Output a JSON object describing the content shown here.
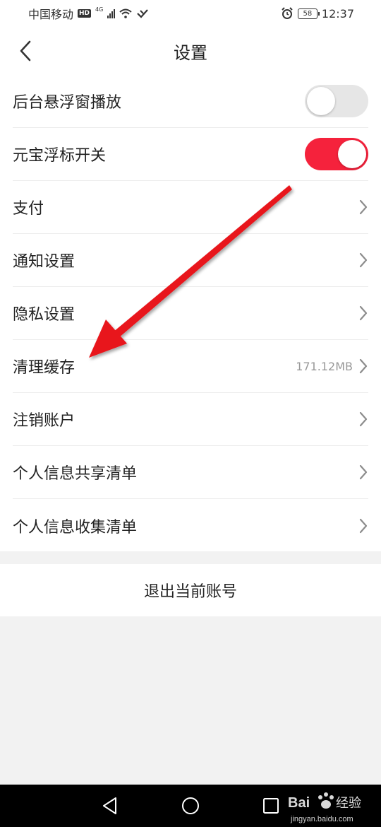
{
  "status_bar": {
    "carrier": "中国移动",
    "hd": "HD",
    "network": "4G",
    "battery": "58",
    "time": "12:37"
  },
  "header": {
    "title": "设置"
  },
  "settings": {
    "items": [
      {
        "label": "后台悬浮窗播放",
        "control": "toggle",
        "on": false
      },
      {
        "label": "元宝浮标开关",
        "control": "toggle",
        "on": true
      },
      {
        "label": "支付",
        "control": "chevron"
      },
      {
        "label": "通知设置",
        "control": "chevron"
      },
      {
        "label": "隐私设置",
        "control": "chevron"
      },
      {
        "label": "清理缓存",
        "control": "chevron",
        "value": "171.12MB"
      },
      {
        "label": "注销账户",
        "control": "chevron"
      },
      {
        "label": "个人信息共享清单",
        "control": "chevron"
      },
      {
        "label": "个人信息收集清单",
        "control": "chevron"
      }
    ]
  },
  "logout": {
    "label": "退出当前账号"
  },
  "watermark": {
    "brand": "Bai 经验",
    "url": "jingyan.baidu.com"
  },
  "colors": {
    "accent": "#f5223c",
    "toggle_off": "#e6e6e6",
    "chevron": "#8c8c8c",
    "arrow": "#e8191f"
  }
}
